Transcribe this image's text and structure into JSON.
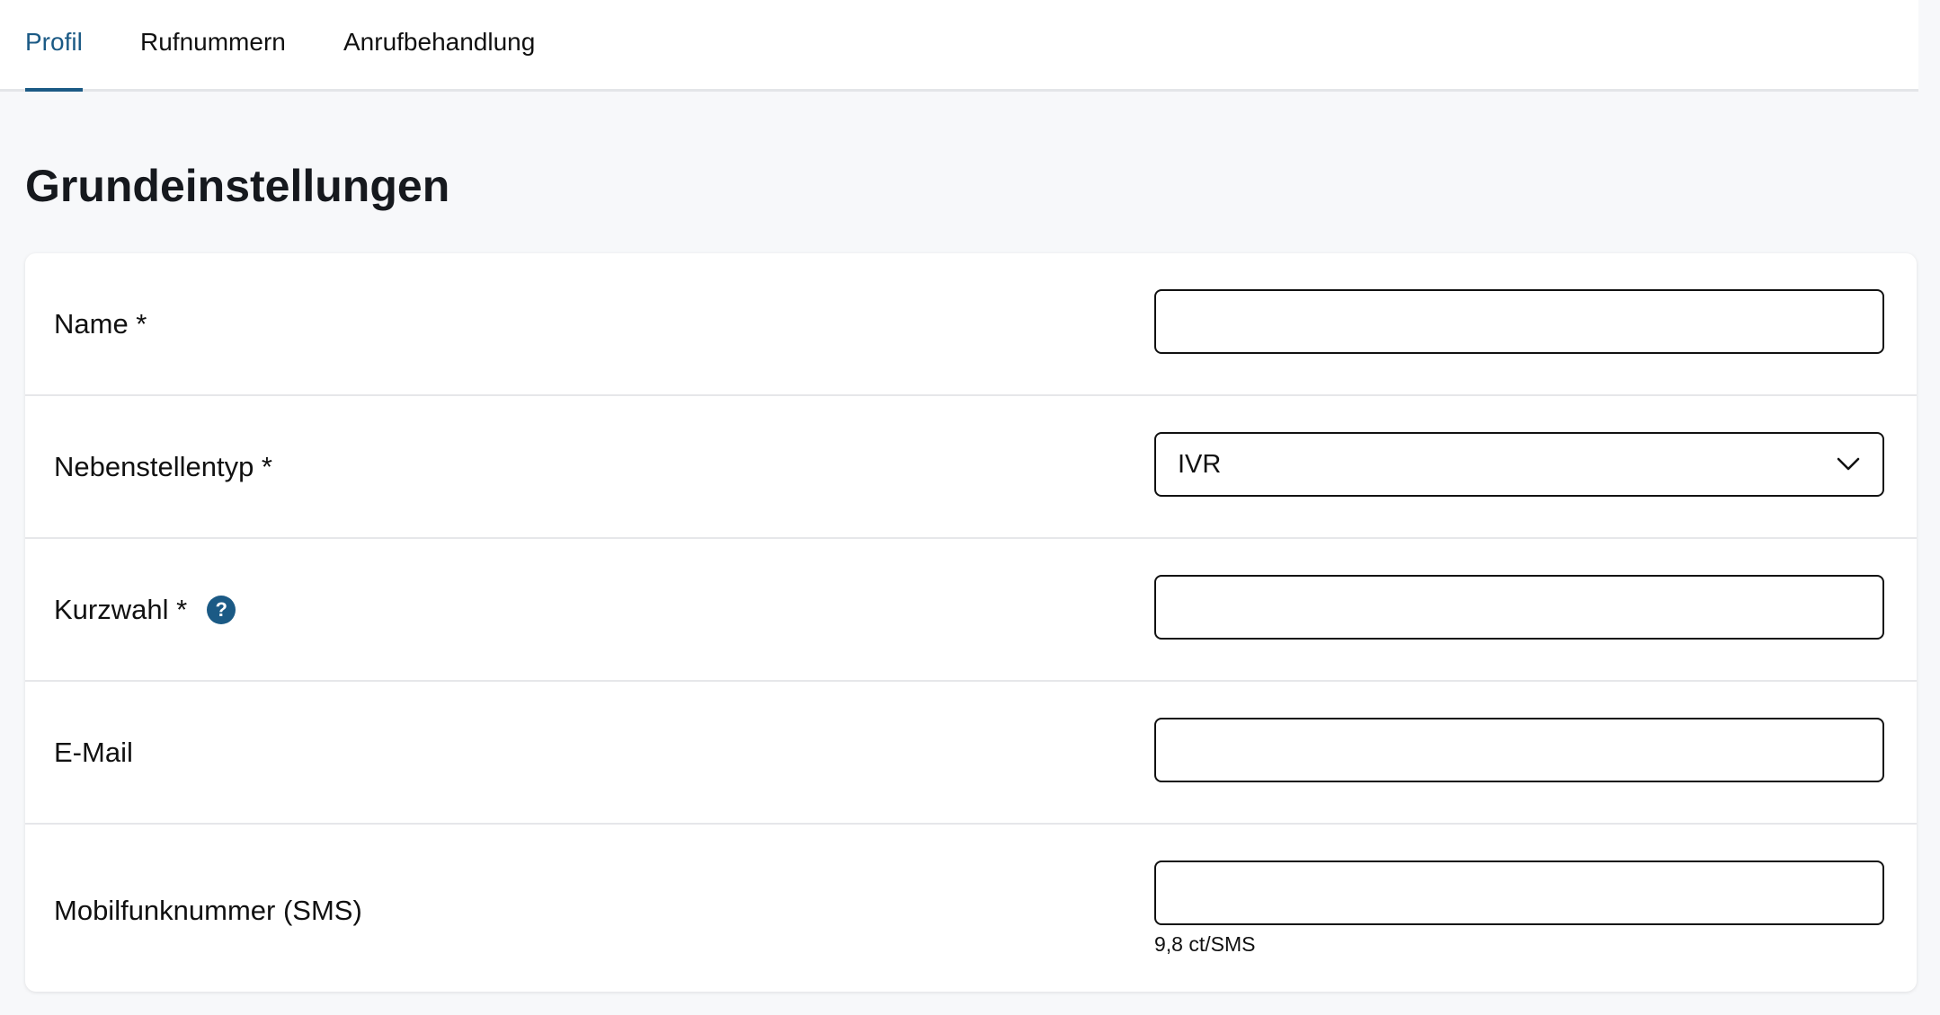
{
  "tabs": [
    {
      "label": "Profil",
      "active": true
    },
    {
      "label": "Rufnummern",
      "active": false
    },
    {
      "label": "Anrufbehandlung",
      "active": false
    }
  ],
  "section_title": "Grundeinstellungen",
  "form": {
    "name": {
      "label": "Name *",
      "value": ""
    },
    "extension_type": {
      "label": "Nebenstellentyp *",
      "value": "IVR"
    },
    "short_dial": {
      "label": "Kurzwahl *",
      "value": "",
      "help_icon": "?"
    },
    "email": {
      "label": "E-Mail",
      "value": ""
    },
    "mobile": {
      "label": "Mobilfunknummer (SMS)",
      "value": "",
      "hint": "9,8 ct/SMS"
    }
  },
  "colors": {
    "accent": "#1b5a85",
    "background": "#f7f8fa",
    "card": "#ffffff",
    "border": "#111111"
  }
}
